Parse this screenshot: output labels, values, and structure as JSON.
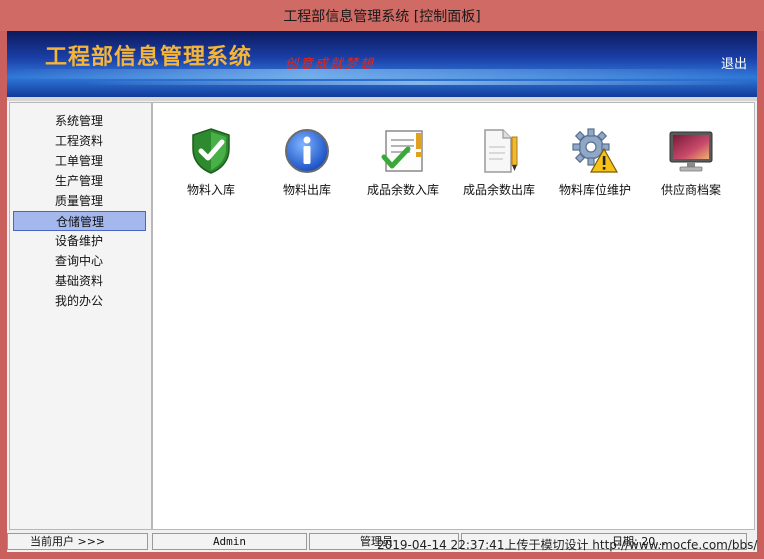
{
  "window": {
    "title": "工程部信息管理系统 [控制面板]"
  },
  "banner": {
    "title": "工程部信息管理系统",
    "slogan": "创意成就梦想",
    "logout_label": "退出"
  },
  "sidebar": {
    "items": [
      {
        "label": "系统管理"
      },
      {
        "label": "工程资料"
      },
      {
        "label": "工单管理"
      },
      {
        "label": "生产管理"
      },
      {
        "label": "质量管理"
      },
      {
        "label": "仓储管理"
      },
      {
        "label": "设备维护"
      },
      {
        "label": "查询中心"
      },
      {
        "label": "基础资料"
      },
      {
        "label": "我的办公"
      }
    ],
    "active_index": 5
  },
  "toolbar": {
    "items": [
      {
        "label": "物料入库",
        "icon": "shield-check-icon"
      },
      {
        "label": "物料出库",
        "icon": "info-icon"
      },
      {
        "label": "成品余数入库",
        "icon": "document-check-icon"
      },
      {
        "label": "成品余数出库",
        "icon": "document-pencil-icon"
      },
      {
        "label": "物料库位维护",
        "icon": "gear-warning-icon"
      },
      {
        "label": "供应商档案",
        "icon": "monitor-icon"
      }
    ]
  },
  "statusbar": {
    "current_user_label": "当前用户 >>>",
    "user": "Admin",
    "role": "管理员",
    "date_label": "日期:",
    "date_value": "20..."
  },
  "watermark": {
    "text": "2019-04-14 22:37:41上传于模切设计 http://www.mocfe.com/bbs/"
  },
  "colors": {
    "accent": "#a5b8ee",
    "title_gold": "#f4b53a",
    "slogan_red": "#e0281e",
    "frame": "#c9605d"
  }
}
